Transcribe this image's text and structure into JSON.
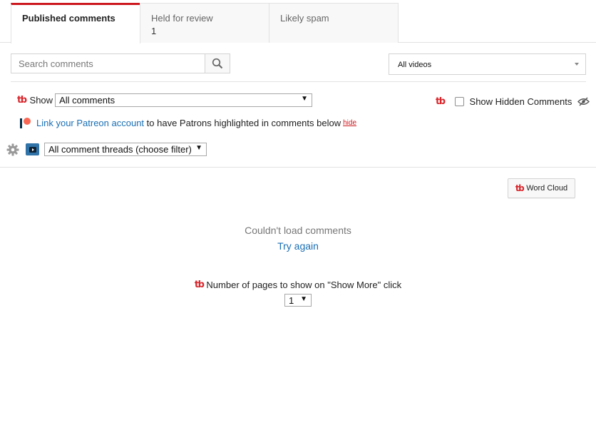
{
  "tabs": [
    {
      "label": "Published comments",
      "count": ""
    },
    {
      "label": "Held for review",
      "count": "1"
    },
    {
      "label": "Likely spam",
      "count": ""
    }
  ],
  "search": {
    "placeholder": "Search comments",
    "value": ""
  },
  "video_filter": {
    "selected": "All videos"
  },
  "show_filter": {
    "label": "Show",
    "selected": "All comments"
  },
  "hidden_comments": {
    "label": "Show Hidden Comments"
  },
  "patreon": {
    "link_text": "Link your Patreon account",
    "text": " to have Patrons highlighted in comments below",
    "hide": "hide"
  },
  "thread_filter": {
    "selected": "All comment threads (choose filter)"
  },
  "word_cloud": {
    "label": "Word Cloud"
  },
  "error": {
    "message": "Couldn't load comments",
    "retry": "Try again"
  },
  "pages": {
    "label": "Number of pages to show on \"Show More\" click",
    "selected": "1"
  },
  "brand": {
    "tb_text": "tb",
    "accent": "#cc181e",
    "link": "#1a6fb4",
    "patreon_coral": "#f96854"
  },
  "icons": [
    "search-icon",
    "chevron-down-icon",
    "tubebuddy-logo-icon",
    "eye-slash-icon",
    "patreon-icon",
    "gear-icon",
    "youtube-play-icon"
  ]
}
